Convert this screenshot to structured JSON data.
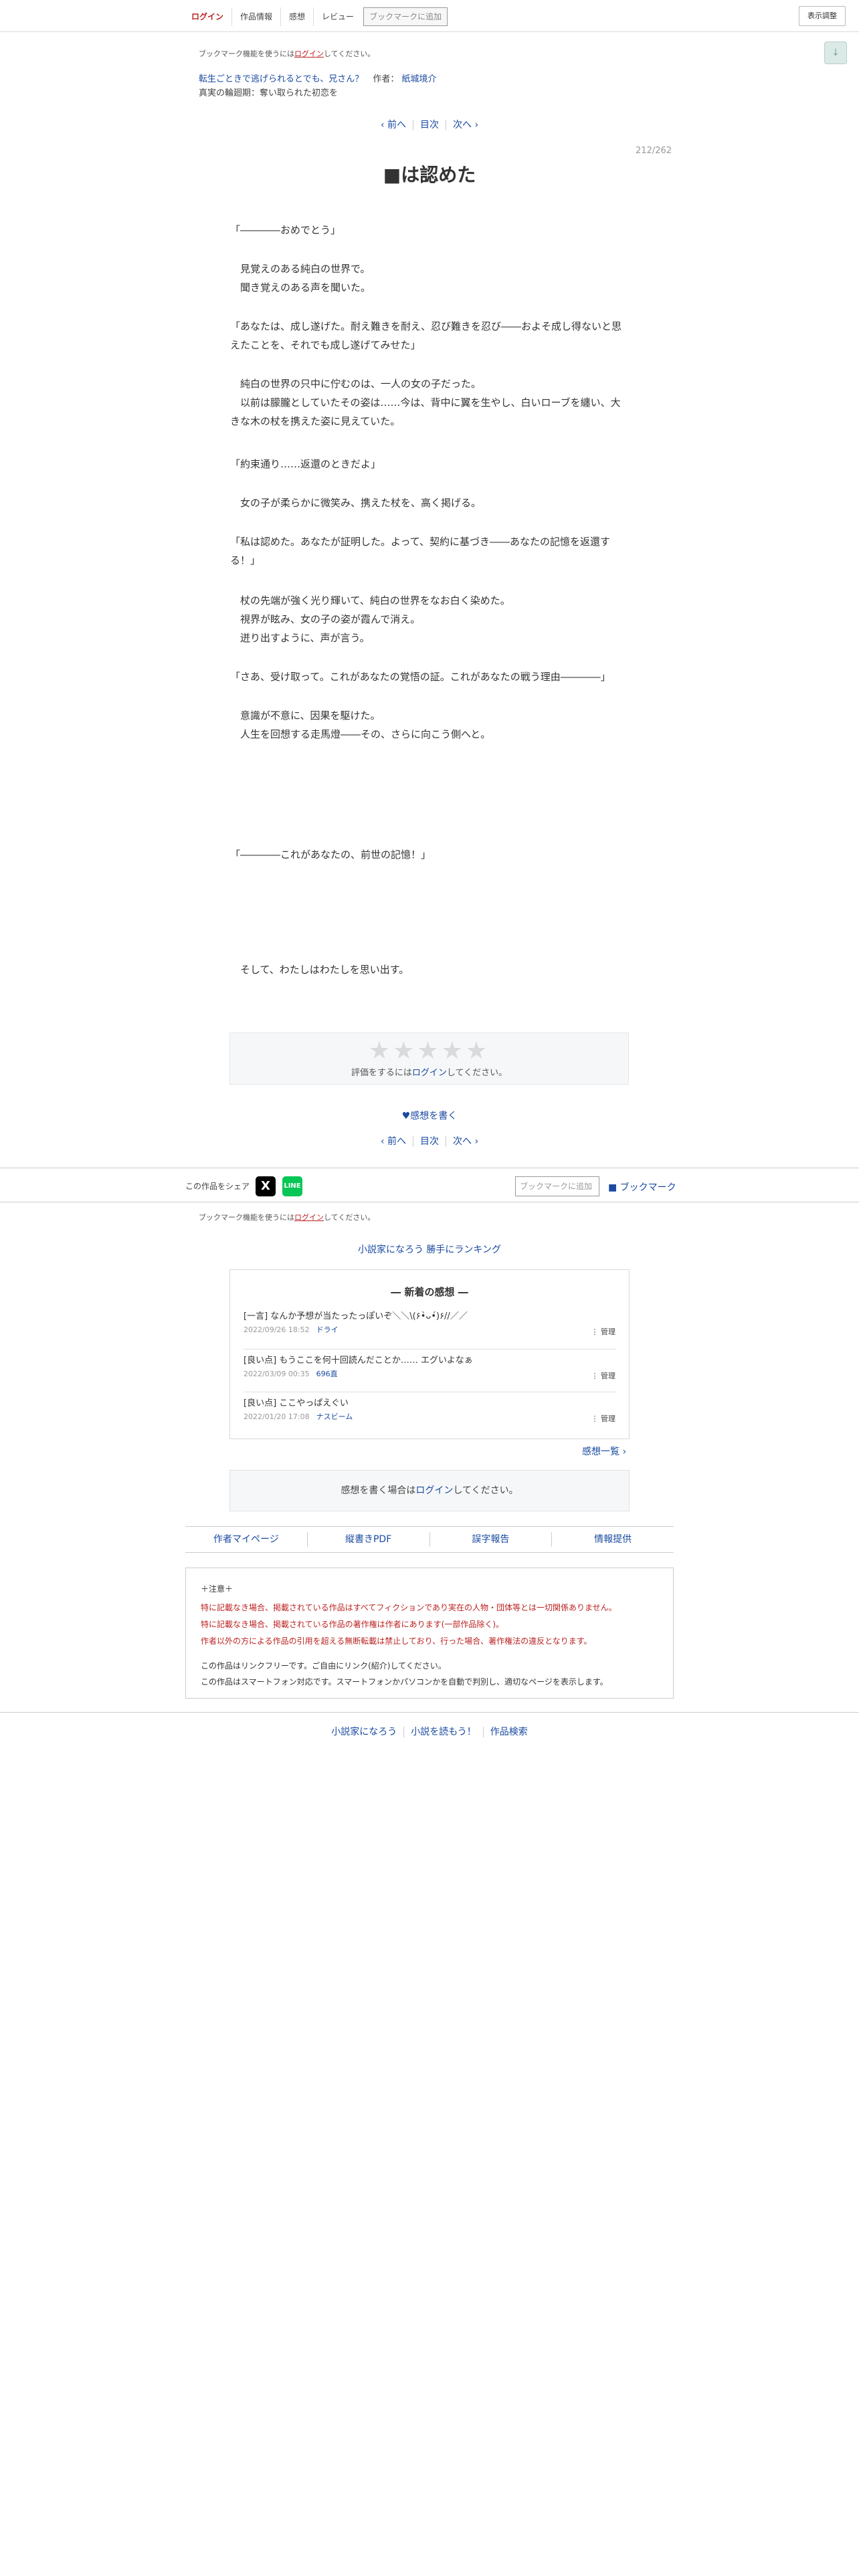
{
  "topnav": {
    "login": "ログイン",
    "info": "作品情報",
    "impressions": "感想",
    "review": "レビュー",
    "bookmark_btn": "ブックマークに追加",
    "display_btn": "表示調整",
    "scroll_icon": "↓"
  },
  "bookmark_note": {
    "prefix": "ブックマーク機能を使うには",
    "login": "ログイン",
    "suffix": "してください。"
  },
  "novel": {
    "title": "転生ごときで逃げられるとでも、兄さん？",
    "author_label": "作者：",
    "author": "紙城境介",
    "arc": "真実の輪廻期：奪い取られた初恋を"
  },
  "pager": {
    "prev": "‹ 前へ",
    "toc": "目次",
    "next": "次へ ›"
  },
  "page_count": "212/262",
  "chapter_title": "■は認めた",
  "paragraphs": [
    "「――――おめでとう」",
    "　見覚えのある純白の世界で。\n　聞き覚えのある声を聞いた。",
    "「あなたは、成し遂げた。耐え難きを耐え、忍び難きを忍び――およそ成し得ないと思えたことを、それでも成し遂げてみせた」",
    "　純白の世界の只中に佇むのは、一人の女の子だった。\n　以前は朦朧としていたその姿は……今は、背中に翼を生やし、白いローブを纏い、大きな木の杖を携えた姿に見えていた。",
    "「約束通り……返還のときだよ」",
    "　女の子が柔らかに微笑み、携えた杖を、高く掲げる。",
    "「私は認めた。あなたが証明した。よって、契約に基づき――あなたの記憶を返還する！」",
    "　杖の先端が強く光り輝いて、純白の世界をなお白く染めた。\n　視界が眩み、女の子の姿が霞んで消え。\n　迸り出すように、声が言う。",
    "「さあ、受け取って。これがあなたの覚悟の証。これがあなたの戦う理由――――」",
    "　意識が不意に、因果を駆けた。\n　人生を回想する走馬燈――その、さらに向こう側へと。",
    "「――――これがあなたの、前世の記憶！」",
    "　そして、わたしはわたしを思い出す。"
  ],
  "rating": {
    "stars": "★★★★★",
    "prefix": "評価をするには",
    "login": "ログイン",
    "suffix": "してください。"
  },
  "write_impression": "♥感想を書く",
  "share": {
    "label": "この作品をシェア",
    "x_icon": "X",
    "line_icon": "LINE",
    "bookmark_input": "ブックマークに追加",
    "bookmark_link": "■ ブックマーク"
  },
  "ranking_link": "小説家になろう 勝手にランキング",
  "impressions": {
    "title": "― 新着の感想 ―",
    "manage": "⋮ 管理",
    "items": [
      {
        "text": "[一言] なんか予想が当たったっぽいぞ＼＼\\(۶•̀ᴗ•́)۶//／／",
        "date": "2022/09/26 18:52",
        "user": "ドライ"
      },
      {
        "text": "[良い点] もうここを何十回読んだことか…… エグいよなぁ",
        "date": "2022/03/09 00:35",
        "user": "696直"
      },
      {
        "text": "[良い点] ここやっぱえぐい",
        "date": "2022/01/20 17:08",
        "user": "ナスビーム"
      }
    ],
    "list_link": "感想一覧 ›"
  },
  "impr_login": {
    "prefix": "感想を書く場合は",
    "login": "ログイン",
    "suffix": "してください。"
  },
  "footer_links": [
    "作者マイページ",
    "縦書きPDF",
    "誤字報告",
    "情報提供"
  ],
  "notice": {
    "head": "＋注意＋",
    "warn": [
      "特に記載なき場合、掲載されている作品はすべてフィクションであり実在の人物・団体等とは一切関係ありません。",
      "特に記載なき場合、掲載されている作品の著作権は作者にあります(一部作品除く)。",
      "作者以外の方による作品の引用を超える無断転載は禁止しており、行った場合、著作権法の違反となります。"
    ],
    "info": [
      "この作品はリンクフリーです。ご自由にリンク(紹介)してください。",
      "この作品はスマートフォン対応です。スマートフォンかパソコンかを自動で判別し、適切なページを表示します。"
    ]
  },
  "bottom_links": [
    "小説家になろう",
    "小説を読もう！",
    "作品検索"
  ]
}
